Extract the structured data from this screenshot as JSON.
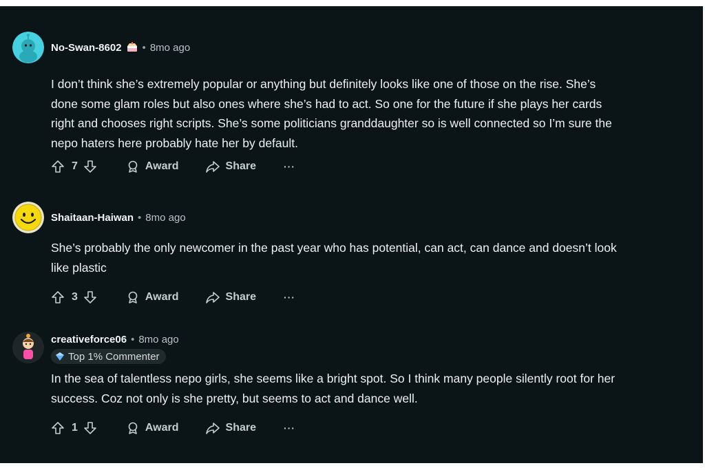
{
  "comments": [
    {
      "author": "No-Swan-8602",
      "flair_icon": "cake-icon",
      "time": "8mo ago",
      "lines": [
        "I don’t think she’s extremely popular or anything but definitely looks like one of those on the rise. She’s",
        "done some glam roles but also ones where she’s had to act. So one for the future if she plays her cards",
        "right and chooses right scripts. She’s some politicians granddaughter so is well connected so I’m sure the",
        "nepo haters here probably hate her by default."
      ],
      "votes": "7",
      "award_label": "Award",
      "share_label": "Share",
      "more_label": "···"
    },
    {
      "author": "Shaitaan-Haiwan",
      "time": "8mo ago",
      "lines": [
        "She’s probably the only newcomer in the past year who has potential, can act, can dance and doesn’t look",
        "like plastic"
      ],
      "votes": "3",
      "award_label": "Award",
      "share_label": "Share",
      "more_label": "···"
    },
    {
      "author": "creativeforce06",
      "time": "8mo ago",
      "badge": "Top 1% Commenter",
      "lines": [
        "In the sea of talentless nepo girls, she seems like a bright spot. So I think many people silently root for her",
        "success. Coz not only is she pretty, but seems to act and dance well."
      ],
      "votes": "1",
      "award_label": "Award",
      "share_label": "Share",
      "more_label": "···"
    }
  ],
  "separator": "•",
  "colors": {
    "background": "#0b1416",
    "text": "#eef1f3",
    "muted": "#b7c5c8",
    "avatar_teal": "#46d1e0",
    "avatar_yellow": "#f5d90a"
  }
}
